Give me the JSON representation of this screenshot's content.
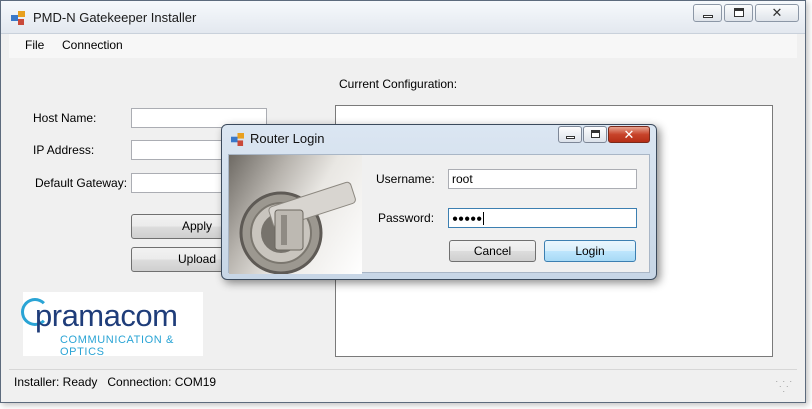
{
  "window": {
    "title": "PMD-N Gatekeeper Installer"
  },
  "menu": {
    "items": [
      "File",
      "Connection"
    ]
  },
  "form": {
    "host_label": "Host Name:",
    "ip_label": "IP Address:",
    "gateway_label": "Default Gateway:",
    "host_value": "",
    "ip_value": "",
    "gateway_value": "",
    "apply_label": "Apply",
    "upload_label": "Upload"
  },
  "config": {
    "label": "Current Configuration:",
    "content": ""
  },
  "logo": {
    "main": "pramacom",
    "sub": "COMMUNICATION & OPTICS"
  },
  "status": {
    "text": "Installer: Ready   Connection: COM19"
  },
  "dialog": {
    "title": "Router Login",
    "username_label": "Username:",
    "username_value": "root",
    "password_label": "Password:",
    "password_masked": "●●●●●",
    "cancel_label": "Cancel",
    "login_label": "Login"
  },
  "icons": [
    "app-icon",
    "minimize-icon",
    "maximize-icon",
    "close-icon",
    "key-lock-image",
    "resize-grip-icon"
  ],
  "colors": {
    "accent": "#3c7fb1",
    "logo_blue": "#1f3d7a",
    "logo_cyan": "#2aa4d5",
    "dialog_close": "#c7432a"
  }
}
